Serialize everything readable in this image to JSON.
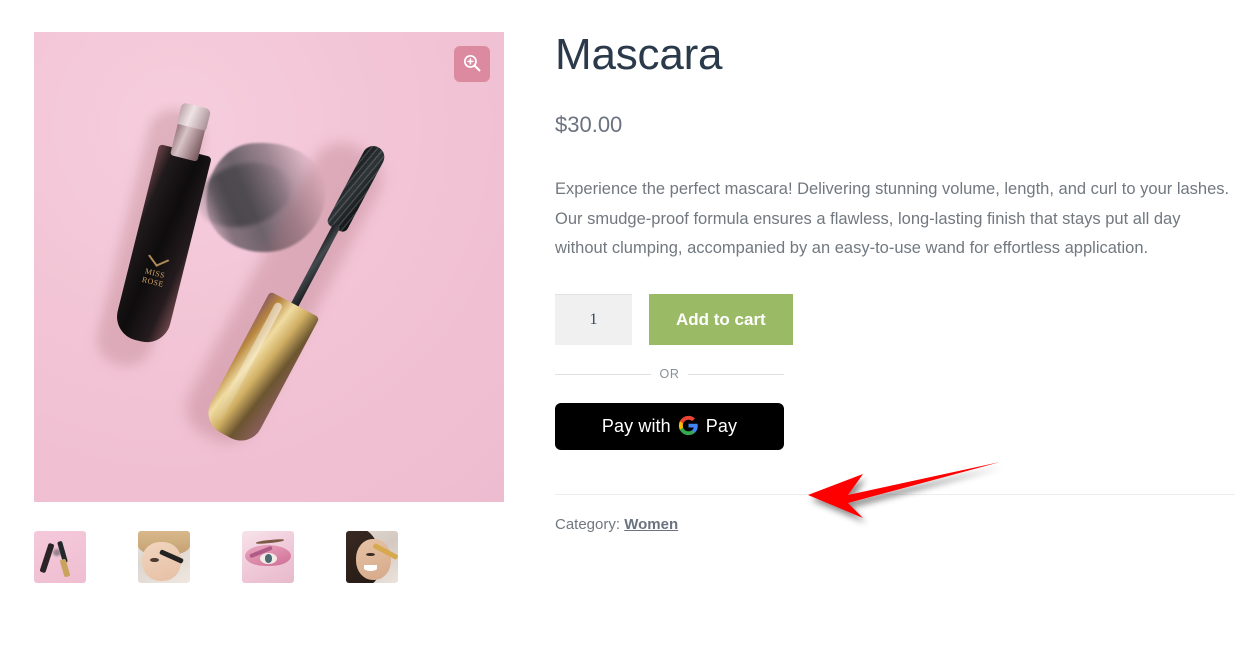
{
  "product": {
    "title": "Mascara",
    "price": "$30.00",
    "description": "Experience the perfect mascara! Delivering stunning volume, length, and curl to your lashes. Our smudge-proof formula ensures a flawless, long-lasting finish that stays put all day without clumping, accompanied by an easy-to-use wand for effortless application.",
    "brand_on_tube": "MISS ROSE"
  },
  "gallery": {
    "zoom_button_icon": "magnify-plus-icon",
    "main_image_alt": "Mascara tube and wand on pink background with black smear",
    "thumbnails": [
      {
        "alt": "Mascara tube and wand on pink background"
      },
      {
        "alt": "Blonde woman applying mascara"
      },
      {
        "alt": "Close-up eye with pink eyeshadow"
      },
      {
        "alt": "Smiling woman applying mascara"
      }
    ]
  },
  "cart": {
    "quantity_value": "1",
    "quantity_placeholder": "1",
    "add_to_cart_label": "Add to cart",
    "or_label": "OR",
    "gpay_prefix": "Pay with",
    "gpay_suffix": "Pay",
    "gpay_logo_icon": "google-g-icon"
  },
  "meta": {
    "category_label": "Category:",
    "category_value": "Women"
  },
  "colors": {
    "title": "#2b3a4a",
    "price": "#6b7280",
    "body_text": "#71787f",
    "add_to_cart_bg": "#9aba65",
    "gpay_bg": "#000000",
    "qty_bg": "#f0f0f0",
    "image_bg": "#f2c6d6",
    "zoom_btn_bg": "#d4748c",
    "annotation_arrow": "#ff0000",
    "google_blue": "#4285f4",
    "google_red": "#ea4335",
    "google_yellow": "#fbbc05",
    "google_green": "#34a853"
  },
  "annotation": {
    "arrow_direction": "left",
    "arrow_target": "gpay-button"
  }
}
